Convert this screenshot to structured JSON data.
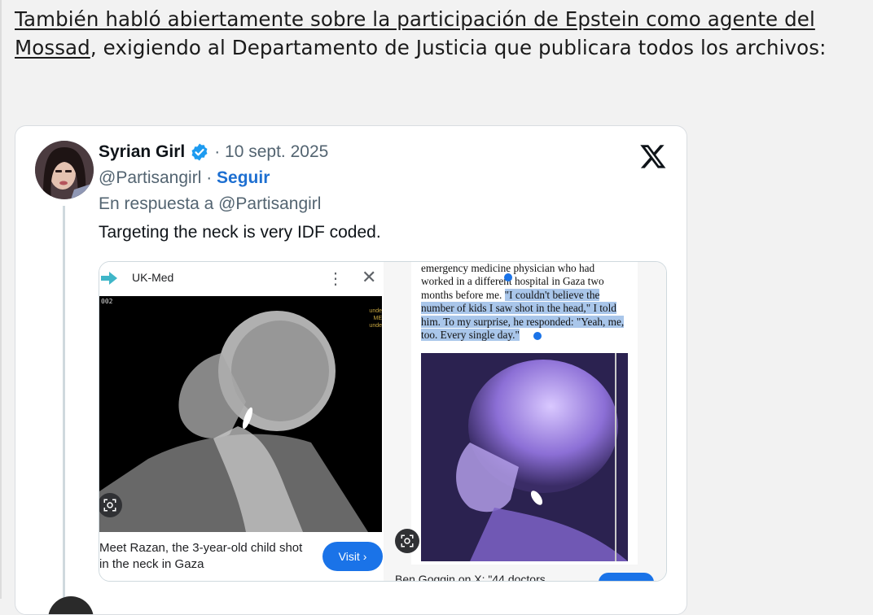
{
  "intro": {
    "link_text": "También habló abiertamente sobre la participación de Epstein como agente del Mossad",
    "rest_text": ", exigiendo al Departamento de Justicia que publicara todos los archivos:"
  },
  "tweet": {
    "author_name": "Syrian Girl",
    "date": "· 10 sept. 2025",
    "handle": "@Partisangirl",
    "separator": "·",
    "follow_label": "Seguir",
    "reply_to": "En respuesta a @Partisangirl",
    "text": "Targeting the neck is very IDF coded.",
    "icons": [
      "verified-badge-icon",
      "x-logo-icon"
    ],
    "accent_color": "#1d6fd1"
  },
  "media": {
    "left": {
      "source_name": "UK-Med",
      "xray_id": "002",
      "xray_side_text": [
        "unde",
        "ME",
        "unde"
      ],
      "caption": "Meet Razan, the 3-year-old child shot in the neck in Gaza",
      "visit_label": "Visit ›",
      "icons": [
        "ukmed-arrow-icon",
        "kebab-menu-icon",
        "close-icon",
        "lens-icon"
      ]
    },
    "right": {
      "book_lines_plain": [
        "emergency medicine physician who had",
        "worked in a different hospital in Gaza two",
        "months before me. "
      ],
      "book_highlight": "\"I couldn't believe the number of kids I saw shot in the head,\" I told him. To my surprise, he responded: \"Yeah, me, too. Every single day.\"",
      "caption": "Ben Goggin on X: \"44 doctors",
      "icons": [
        "lens-icon"
      ]
    }
  }
}
